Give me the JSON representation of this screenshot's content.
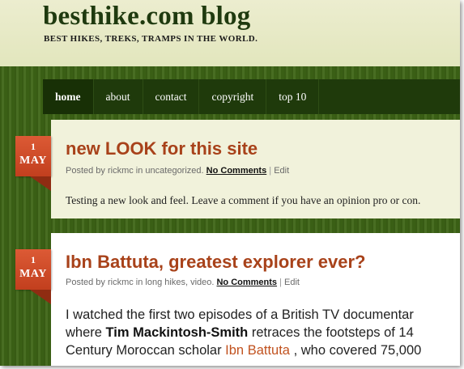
{
  "header": {
    "site_title": "besthike.com blog",
    "tagline": "BEST HIKES, TREKS, TRAMPS IN THE WORLD."
  },
  "nav": {
    "items": [
      {
        "label": "home",
        "active": true
      },
      {
        "label": "about"
      },
      {
        "label": "contact"
      },
      {
        "label": "copyright"
      },
      {
        "label": "top 10"
      }
    ]
  },
  "posts": [
    {
      "day": "1",
      "month": "MAY",
      "title": "new LOOK for this site",
      "meta_prefix": "Posted by rickmc in uncategorized.",
      "comments": "No Comments",
      "sep": "|",
      "edit": "Edit",
      "excerpt": "Testing a new look and feel. Leave a comment if you have an opinion pro or con."
    },
    {
      "day": "1",
      "month": "MAY",
      "title": "Ibn Battuta, greatest explorer ever?",
      "meta_prefix": "Posted by rickmc in long hikes, video.",
      "comments": "No Comments",
      "sep": "|",
      "edit": "Edit",
      "line1": "I watched the first two episodes of a British TV documentar",
      "line2_a": "where ",
      "line2_b": "Tim Mackintosh-Smith",
      "line2_c": " retraces the footsteps of 14",
      "line3_a": "Century Moroccan scholar ",
      "line3_link": "Ibn Battuta",
      "line3_b": " , who covered 75,000"
    }
  ],
  "colors": {
    "header_bg": "#e6e9c6",
    "nav_bg": "#1f3a0b",
    "page_bg": "#3e6516",
    "accent": "#a8421a",
    "badge": "#d4502c"
  }
}
